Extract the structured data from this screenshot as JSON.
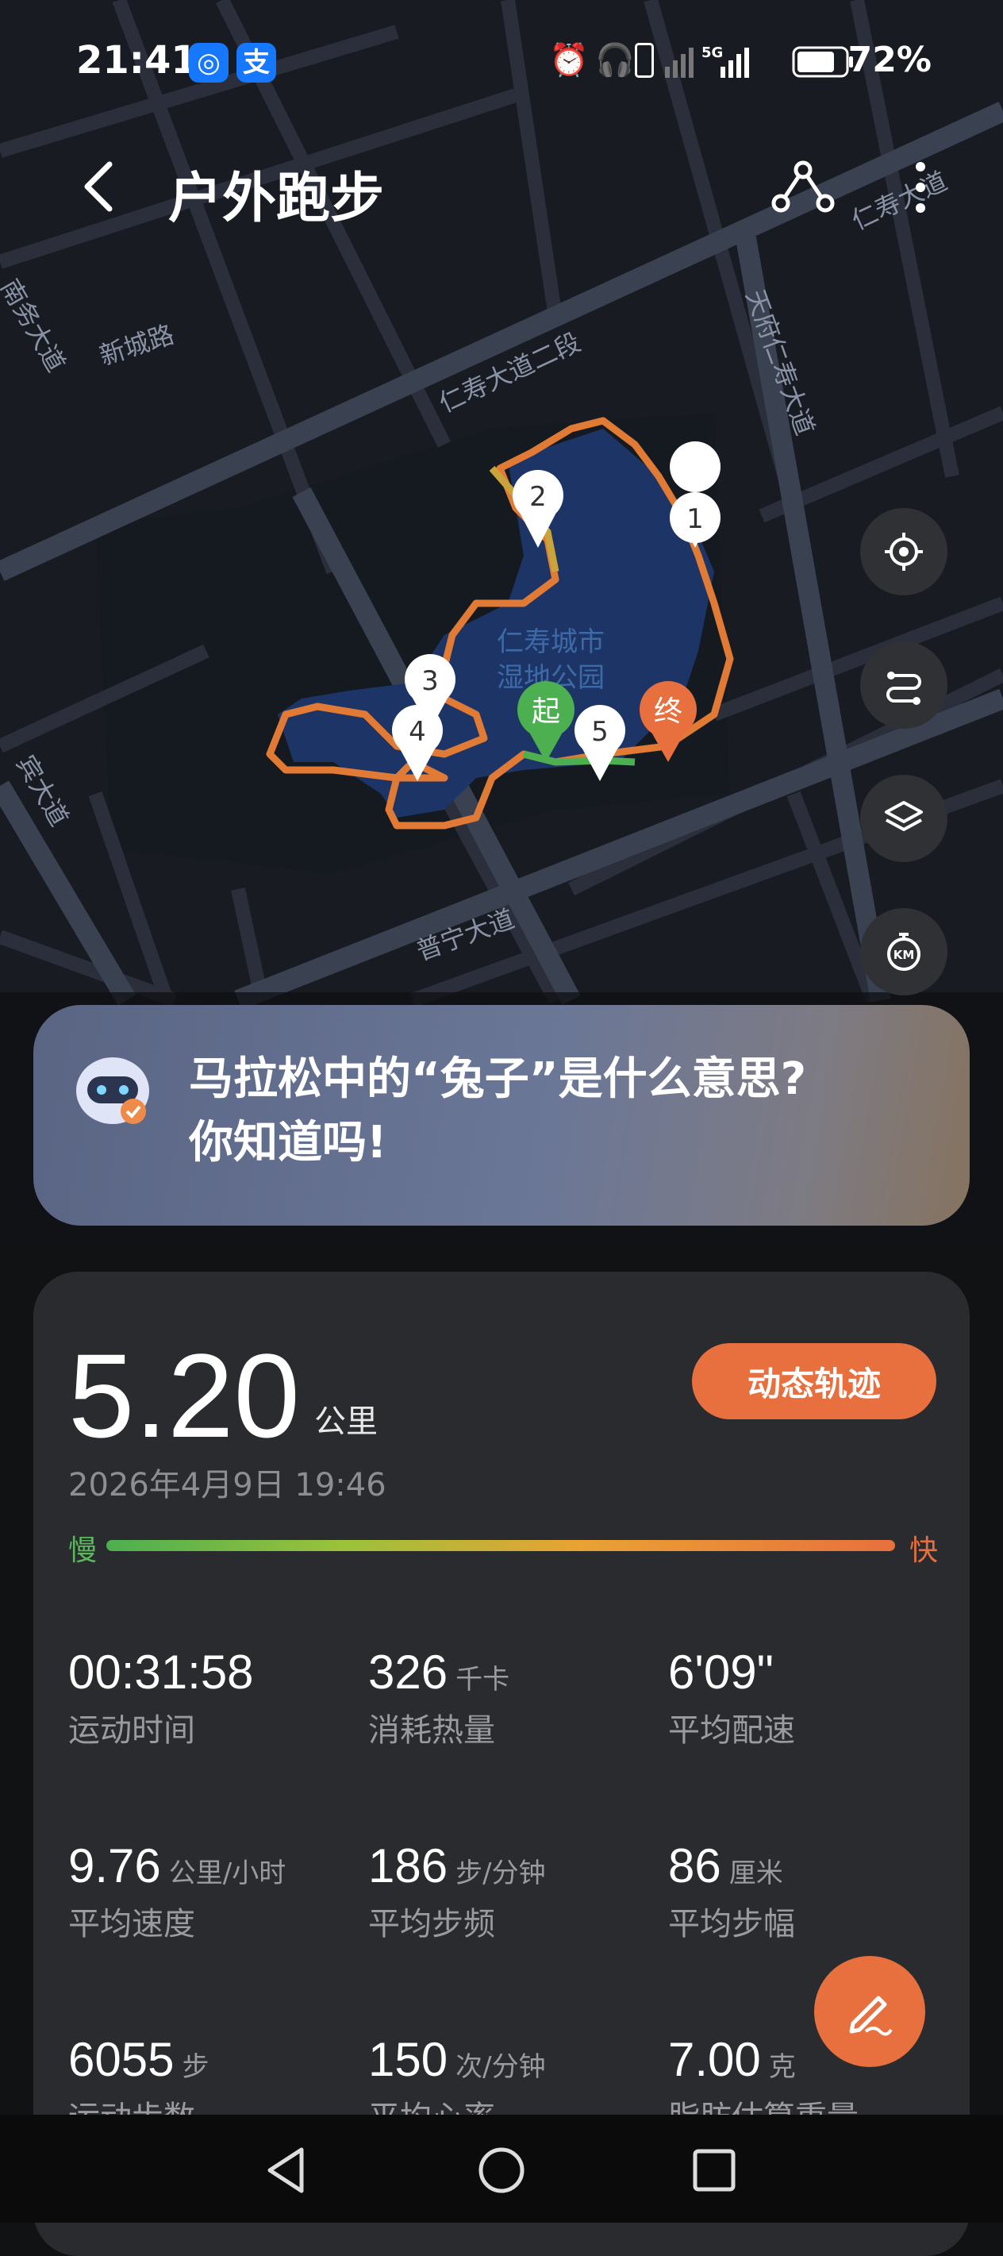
{
  "status_bar": {
    "time": "21:41",
    "app_icon_1": "location-app-icon",
    "app_icon_2_label": "支",
    "icons": [
      "alarm-icon",
      "headphones-icon",
      "vibrate-icon",
      "signal-x-icon",
      "5g-signal-icon",
      "battery-icon"
    ],
    "battery": "72%"
  },
  "header": {
    "title": "户外跑步"
  },
  "map": {
    "roads": [
      "新城路",
      "仁寿大道二段",
      "仁寿大道",
      "天府仁寿大道",
      "普宁大道",
      "南务大道",
      "宾大道"
    ],
    "park_label_1": "仁寿城市",
    "park_label_2": "湿地公园",
    "markers": [
      "1",
      "2",
      "3",
      "4",
      "5"
    ],
    "start_label": "起",
    "end_label": "终"
  },
  "ai_prompt": {
    "line1": "马拉松中的“兔子”是什么意思?",
    "line2": "你知道吗!"
  },
  "summary": {
    "distance": "5.20",
    "distance_unit": "公里",
    "dynamic_track_label": "动态轨迹",
    "date": "2026年4月9日 19:46",
    "slow_label": "慢",
    "fast_label": "快",
    "stats": [
      {
        "value": "00:31:58",
        "unit": "",
        "label": "运动时间"
      },
      {
        "value": "326",
        "unit": "千卡",
        "label": "消耗热量"
      },
      {
        "value": "6'09\"",
        "unit": "",
        "label": "平均配速"
      },
      {
        "value": "9.76",
        "unit": "公里/小时",
        "label": "平均速度"
      },
      {
        "value": "186",
        "unit": "步/分钟",
        "label": "平均步频"
      },
      {
        "value": "86",
        "unit": "厘米",
        "label": "平均步幅"
      },
      {
        "value": "6055",
        "unit": "步",
        "label": "运动步数"
      },
      {
        "value": "150",
        "unit": "次/分钟",
        "label": "平均心率"
      },
      {
        "value": "7.00",
        "unit": "克",
        "label": "脂肪估算重量"
      }
    ]
  },
  "colors": {
    "accent": "#e8703e",
    "slow": "#4caf50",
    "card": "#2a2b2e",
    "route_orange": "#e07a35",
    "water": "#1d3566"
  }
}
